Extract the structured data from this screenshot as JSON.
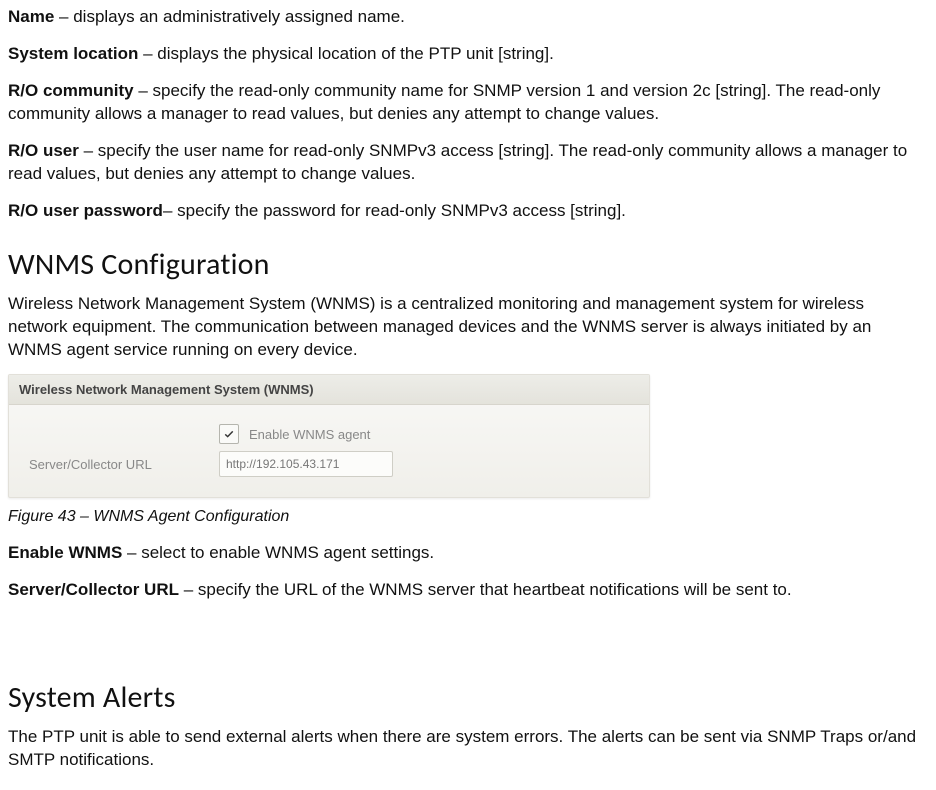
{
  "defs": {
    "name": {
      "term": "Name",
      "desc": " – displays an administratively assigned name."
    },
    "sysloc": {
      "term": "System location",
      "desc": " – displays the physical location of the PTP unit [string]."
    },
    "rocom": {
      "term": "R/O community",
      "desc": " – specify the read-only community name for SNMP version 1 and version 2c [string]. The read-only community allows a manager to read values, but denies any attempt to change values."
    },
    "rouser": {
      "term": "R/O user",
      "desc": " – specify the user name for read-only SNMPv3 access [string]. The read-only community allows a manager to read values, but denies any attempt to change values."
    },
    "ropass": {
      "term": "R/O user password",
      "desc": "– specify the password for read-only SNMPv3 access [string]."
    },
    "enablewnms": {
      "term": "Enable WNMS",
      "desc": " – select to enable WNMS agent settings."
    },
    "serverurl": {
      "term": "Server/Collector URL",
      "desc": " – specify the URL of the WNMS server that heartbeat notifications will be sent to."
    }
  },
  "sections": {
    "wnms_heading": "WNMS Configuration",
    "wnms_body": "Wireless Network Management System (WNMS) is a centralized monitoring and management system for wireless network equipment. The communication between managed devices and the WNMS server is always initiated by an WNMS agent service running on every device.",
    "alerts_heading": "System Alerts",
    "alerts_body": "The PTP unit is able to send external alerts when there are system errors. The alerts can be sent via SNMP Traps or/and SMTP notifications."
  },
  "panel": {
    "title": "Wireless Network Management System (WNMS)",
    "enable_label": "Enable WNMS agent",
    "server_label": "Server/Collector URL",
    "server_value": "http://192.105.43.171"
  },
  "figure_caption": "Figure 43 – WNMS Agent Configuration"
}
